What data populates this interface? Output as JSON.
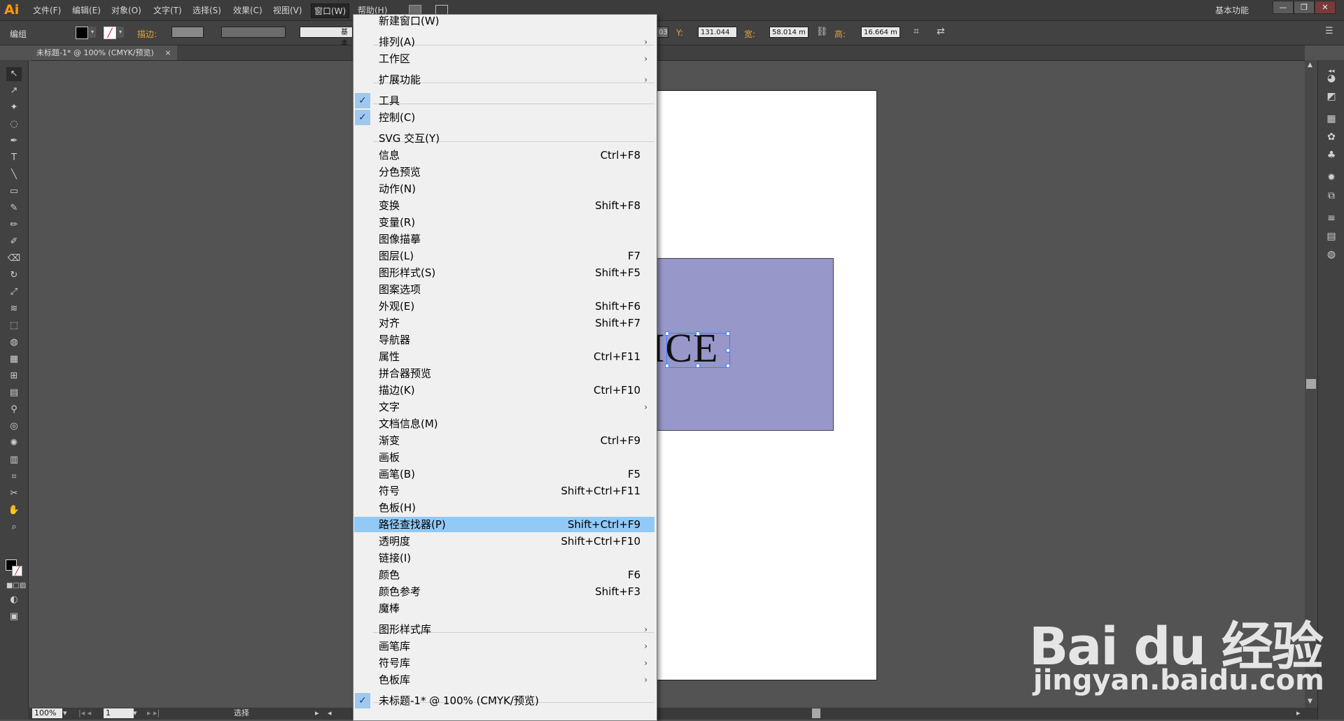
{
  "app": {
    "logo": "Ai"
  },
  "menubar": {
    "items": [
      "文件(F)",
      "编辑(E)",
      "对象(O)",
      "文字(T)",
      "选择(S)",
      "效果(C)",
      "视图(V)",
      "窗口(W)",
      "帮助(H)"
    ],
    "workspace": "基本功能",
    "window_buttons": [
      "—",
      "❐",
      "✕"
    ]
  },
  "control": {
    "selection_label": "编组",
    "stroke_label": "描边:",
    "stroke_style": "基本",
    "x_value": "03",
    "y_label": "Y:",
    "y_value": "131.044",
    "w_label": "宽:",
    "w_value": "58.014 m",
    "h_label": "高:",
    "h_value": "16.664 m"
  },
  "document": {
    "tab_title": "未标题-1* @ 100% (CMYK/预览)",
    "tab_close": "×"
  },
  "canvas": {
    "art_text": "ICE",
    "rect_color": "#9797c9"
  },
  "window_menu": {
    "items": [
      {
        "label": "新建窗口(W)",
        "shortcut": ""
      },
      {
        "label": "排列(A)",
        "shortcut": "",
        "submenu": true
      },
      {
        "label": "工作区",
        "shortcut": "",
        "submenu": true
      },
      {
        "label": "扩展功能",
        "shortcut": "",
        "submenu": true
      },
      {
        "label": "工具",
        "shortcut": "",
        "checked": true
      },
      {
        "label": "控制(C)",
        "shortcut": "",
        "checked": true
      },
      {
        "label": "SVG 交互(Y)",
        "shortcut": ""
      },
      {
        "label": "信息",
        "shortcut": "Ctrl+F8"
      },
      {
        "label": "分色预览",
        "shortcut": ""
      },
      {
        "label": "动作(N)",
        "shortcut": ""
      },
      {
        "label": "变换",
        "shortcut": "Shift+F8"
      },
      {
        "label": "变量(R)",
        "shortcut": ""
      },
      {
        "label": "图像描摹",
        "shortcut": ""
      },
      {
        "label": "图层(L)",
        "shortcut": "F7"
      },
      {
        "label": "图形样式(S)",
        "shortcut": "Shift+F5"
      },
      {
        "label": "图案选项",
        "shortcut": ""
      },
      {
        "label": "外观(E)",
        "shortcut": "Shift+F6"
      },
      {
        "label": "对齐",
        "shortcut": "Shift+F7"
      },
      {
        "label": "导航器",
        "shortcut": ""
      },
      {
        "label": "属性",
        "shortcut": "Ctrl+F11"
      },
      {
        "label": "拼合器预览",
        "shortcut": ""
      },
      {
        "label": "描边(K)",
        "shortcut": "Ctrl+F10"
      },
      {
        "label": "文字",
        "shortcut": "",
        "submenu": true
      },
      {
        "label": "文档信息(M)",
        "shortcut": ""
      },
      {
        "label": "渐变",
        "shortcut": "Ctrl+F9"
      },
      {
        "label": "画板",
        "shortcut": ""
      },
      {
        "label": "画笔(B)",
        "shortcut": "F5"
      },
      {
        "label": "符号",
        "shortcut": "Shift+Ctrl+F11"
      },
      {
        "label": "色板(H)",
        "shortcut": ""
      },
      {
        "label": "路径查找器(P)",
        "shortcut": "Shift+Ctrl+F9",
        "highlighted": true
      },
      {
        "label": "透明度",
        "shortcut": "Shift+Ctrl+F10"
      },
      {
        "label": "链接(I)",
        "shortcut": ""
      },
      {
        "label": "颜色",
        "shortcut": "F6"
      },
      {
        "label": "颜色参考",
        "shortcut": "Shift+F3"
      },
      {
        "label": "魔棒",
        "shortcut": ""
      },
      {
        "label": "图形样式库",
        "shortcut": "",
        "submenu": true
      },
      {
        "label": "画笔库",
        "shortcut": "",
        "submenu": true
      },
      {
        "label": "符号库",
        "shortcut": "",
        "submenu": true
      },
      {
        "label": "色板库",
        "shortcut": "",
        "submenu": true
      },
      {
        "label": "未标题-1* @ 100% (CMYK/预览)",
        "shortcut": "",
        "checked": true
      }
    ]
  },
  "status": {
    "zoom": "100%",
    "page": "1",
    "mode": "选择"
  },
  "watermark": {
    "main": "Bai du 经验",
    "sub": "jingyan.baidu.com"
  }
}
